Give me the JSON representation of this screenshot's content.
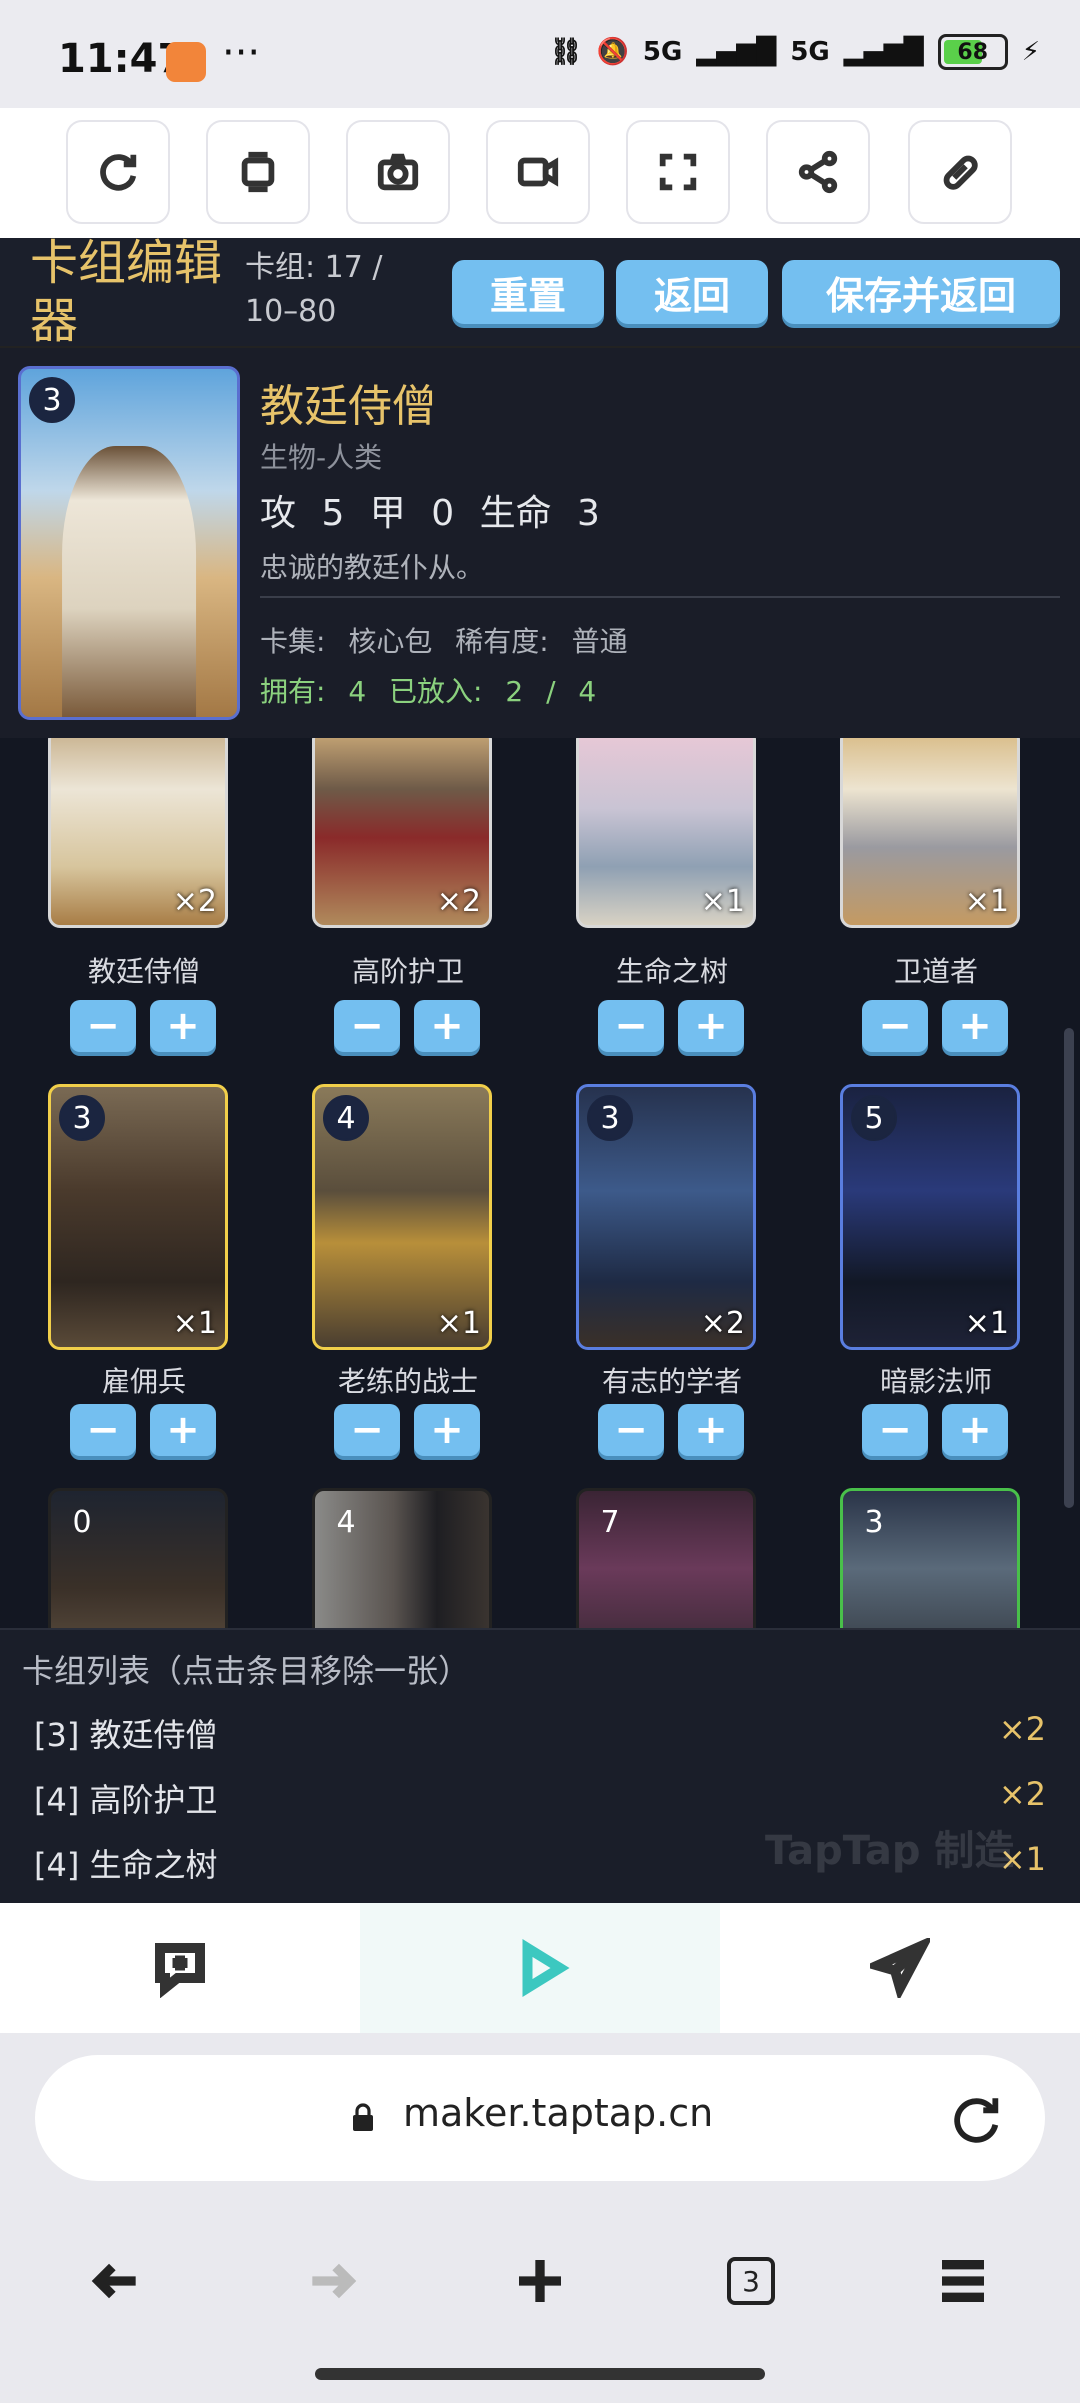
{
  "status": {
    "time": "11:47",
    "dots": "···",
    "signal1": "5G",
    "signal2": "5G",
    "battery": "68"
  },
  "toolbar": [
    "refresh-icon",
    "layers-icon",
    "camera-icon",
    "video-icon",
    "fullscreen-icon",
    "share-icon",
    "link-icon"
  ],
  "header": {
    "title": "卡组编辑器",
    "deck_count": "卡组: 17 / 10–80",
    "reset": "重置",
    "back": "返回",
    "save_back": "保存并返回"
  },
  "detail": {
    "cost": "3",
    "name": "教廷侍僧",
    "type": "生物-人类",
    "stats": "攻 5   甲 0   生命 3",
    "desc": "忠诚的教廷仆从。",
    "meta": "卡集: 核心包   稀有度: 普通",
    "own": "拥有: 4   已放入: 2 / 4"
  },
  "cards": [
    {
      "name": "教廷侍僧",
      "qty": "×2",
      "cost": ""
    },
    {
      "name": "高阶护卫",
      "qty": "×2",
      "cost": ""
    },
    {
      "name": "生命之树",
      "qty": "×1",
      "cost": ""
    },
    {
      "name": "卫道者",
      "qty": "×1",
      "cost": ""
    },
    {
      "name": "雇佣兵",
      "qty": "×1",
      "cost": "3"
    },
    {
      "name": "老练的战士",
      "qty": "×1",
      "cost": "4"
    },
    {
      "name": "有志的学者",
      "qty": "×2",
      "cost": "3"
    },
    {
      "name": "暗影法师",
      "qty": "×1",
      "cost": "5"
    },
    {
      "name": "",
      "qty": "",
      "cost": "0"
    },
    {
      "name": "",
      "qty": "",
      "cost": "4"
    },
    {
      "name": "",
      "qty": "",
      "cost": "7"
    },
    {
      "name": "",
      "qty": "",
      "cost": "3"
    }
  ],
  "buttons": {
    "minus": "−",
    "plus": "+"
  },
  "decklist": {
    "title": "卡组列表（点击条目移除一张）",
    "items": [
      {
        "label": "[3] 教廷侍僧",
        "count": "×2"
      },
      {
        "label": "[4] 高阶护卫",
        "count": "×2"
      },
      {
        "label": "[4] 生命之树",
        "count": "×1"
      }
    ]
  },
  "watermark": "TapTap 制造",
  "browser": {
    "url": "maker.taptap.cn",
    "tabs": "3"
  },
  "colors": {
    "gold": "#e7c36a",
    "blue_btn": "#74bff0",
    "bg": "#131722",
    "green": "#8bd17e",
    "play": "#3cc8c0"
  }
}
